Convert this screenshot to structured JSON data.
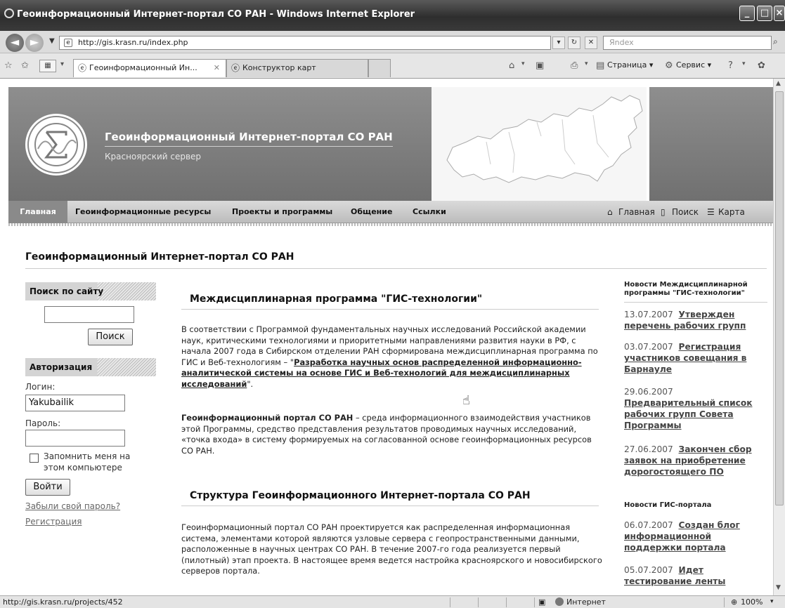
{
  "window": {
    "title": "Геоинформационный Интернет-портал СО РАН - Windows Internet Explorer",
    "url": "http://gis.krasn.ru/index.php",
    "search_placeholder": "Яndex"
  },
  "tabs": [
    {
      "label": "Геоинформационный Ин..."
    },
    {
      "label": "Конструктор карт"
    }
  ],
  "commands": {
    "page": "Страница ▾",
    "service": "Сервис ▾"
  },
  "status": {
    "url": "http://gis.krasn.ru/projects/452",
    "zone": "Интернет",
    "zoom": "100%"
  },
  "site": {
    "title": "Геоинформационный Интернет-портал СО РАН",
    "subtitle": "Красноярский сервер"
  },
  "nav": {
    "items": [
      "Главная",
      "Геоинформационные ресурсы",
      "Проекты и программы",
      "Общение",
      "Ссылки"
    ],
    "util_home": "Главная",
    "util_search": "Поиск",
    "util_map": "Карта"
  },
  "page_title": "Геоинформационный Интернет-портал СО РАН",
  "sidebar": {
    "search_title": "Поиск по сайту",
    "search_value": "",
    "search_button": "Поиск",
    "auth_title": "Авторизация",
    "login_label": "Логин:",
    "login_value": "Yakubailik",
    "password_label": "Пароль:",
    "remember_label": "Запомнить меня на этом компьютере",
    "login_button": "Войти",
    "forgot_link": "Забыли свой пароль?",
    "register_link": "Регистрация"
  },
  "main": {
    "heading1": "Междисциплинарная программа \"ГИС-технологии\"",
    "p1_text": "В соответствии с Программой фундаментальных научных исследований Российской академии наук, критическими технологиями и приоритетными направлениями развития науки в РФ, с начала 2007 года в Сибирском отделении РАН сформирована междисциплинарная программа по ГИС и Веб-технологиям – \"",
    "p1_link": "Разработка научных основ распределенной информационно-аналитической системы на основе ГИС и Веб-технологий для междисциплинарных исследований",
    "p1_tail": "\".",
    "p2_bold": "Геоинформационный портал СО РАН",
    "p2_text": " –  среда информационного взаимодействия участников этой Программы, средство представления результатов проводимых научных исследований, «точка входа» в систему формируемых на согласованной основе геоинформационных ресурсов СО РАН.",
    "heading2": "Структура Геоинформационного Интернет-портала СО РАН",
    "p3_text": "Геоинформационный портал СО РАН проектируется как распределенная информационная система, элементами которой являются узловые сервера с геопространственными данными, расположенные в научных центрах СО РАН. В течение 2007-го года реализуется первый (пилотный) этап проекта. В настоящее время ведется настройка красноярского и новосибирского серверов портала."
  },
  "news": {
    "block1_title": "Новости Междисциплинарной программы \"ГИС-технологии\"",
    "block1_items": [
      {
        "date": "13.07.2007",
        "title": "Утвержден перечень рабочих групп"
      },
      {
        "date": "03.07.2007",
        "title": "Регистрация участников совещания в Барнауле"
      },
      {
        "date": "29.06.2007",
        "title": "Предварительный список рабочих групп Совета Программы"
      },
      {
        "date": "27.06.2007",
        "title": "Закончен сбор заявок на приобретение дорогостоящего ПО"
      }
    ],
    "block2_title": "Новости ГИС-портала",
    "block2_items": [
      {
        "date": "06.07.2007",
        "title": "Создан блог информационной поддержки портала"
      },
      {
        "date": "05.07.2007",
        "title": "Идет тестирование ленты"
      }
    ]
  }
}
